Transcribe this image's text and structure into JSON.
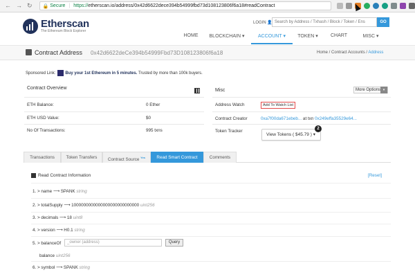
{
  "browser": {
    "secure_label": "Secure",
    "url_scheme": "https://",
    "url_rest": "etherscan.io/address/0x42d6622dece394b54999fbd73d108123806f6a18#readContract"
  },
  "header": {
    "logo_name": "Etherscan",
    "logo_tagline": "The Ethereum Block Explorer",
    "login_label": "LOGIN",
    "search_placeholder": "Search by Address / Txhash / Block / Token / Ens",
    "search_button": "GO",
    "nav": [
      {
        "label": "HOME"
      },
      {
        "label": "BLOCKCHAIN ▾"
      },
      {
        "label": "ACCOUNT ▾"
      },
      {
        "label": "TOKEN ▾"
      },
      {
        "label": "CHART"
      },
      {
        "label": "MISC ▾"
      }
    ]
  },
  "title_band": {
    "title": "Contract Address",
    "address": "0x42d6622deCe394b54999Fbd73D108123806f6a18",
    "breadcrumb": [
      "Home",
      "Contract Accounts",
      "Address"
    ]
  },
  "sponsored": {
    "label": "Sponsored Link:",
    "link": "Buy your 1st Ethereum in 5 minutes.",
    "text": " Trusted by more than 100k buyers."
  },
  "overview": {
    "title": "Contract Overview",
    "eth_balance_label": "ETH Balance:",
    "eth_balance_value": "0 Ether",
    "usd_label": "ETH USD Value:",
    "usd_value": "$0",
    "tx_label": "No Of Transactions:",
    "tx_value": "995 txns"
  },
  "misc": {
    "title": "Misc",
    "more_options": "More Options",
    "watch_label": "Address Watch",
    "watch_button": "Add To Watch List",
    "creator_label": "Contract Creator",
    "creator_address": "0xa7f00da671ebeb...",
    "at_txn": " at txn ",
    "creator_txn": "0x249effa35529e64...",
    "tracker_label": "Token Tracker",
    "tokens_button": "View Tokens ( $45.79 )",
    "tokens_count": "2"
  },
  "tabs": [
    {
      "label": "Transactions"
    },
    {
      "label": "Token Transfers"
    },
    {
      "label": "Contract Source",
      "badge": "Yes"
    },
    {
      "label": "Read Smart Contract"
    },
    {
      "label": "Comments"
    }
  ],
  "read_contract": {
    "title": "Read Contract Information",
    "reset": "[Reset]",
    "functions": [
      {
        "label": "1. > name",
        "result": "SPANK",
        "type": "string"
      },
      {
        "label": "2. > totalSupply",
        "result": "1000000000000000000000000000",
        "type": "uint256"
      },
      {
        "label": "3. > decimals",
        "result": "18",
        "type": "uint8"
      },
      {
        "label": "4. > version",
        "result": "H0.1",
        "type": "string"
      },
      {
        "label": "5. > balanceOf",
        "input_placeholder": "_owner (address)",
        "query_button": "Query"
      },
      {
        "label": "6. > symbol",
        "result": "SPANK",
        "type": "string"
      }
    ],
    "balance_output_label": "balance",
    "balance_output_type": "uint256"
  },
  "colors": {
    "accent": "#3498db",
    "brand": "#21325b",
    "watch_border": "#e34a4a"
  }
}
